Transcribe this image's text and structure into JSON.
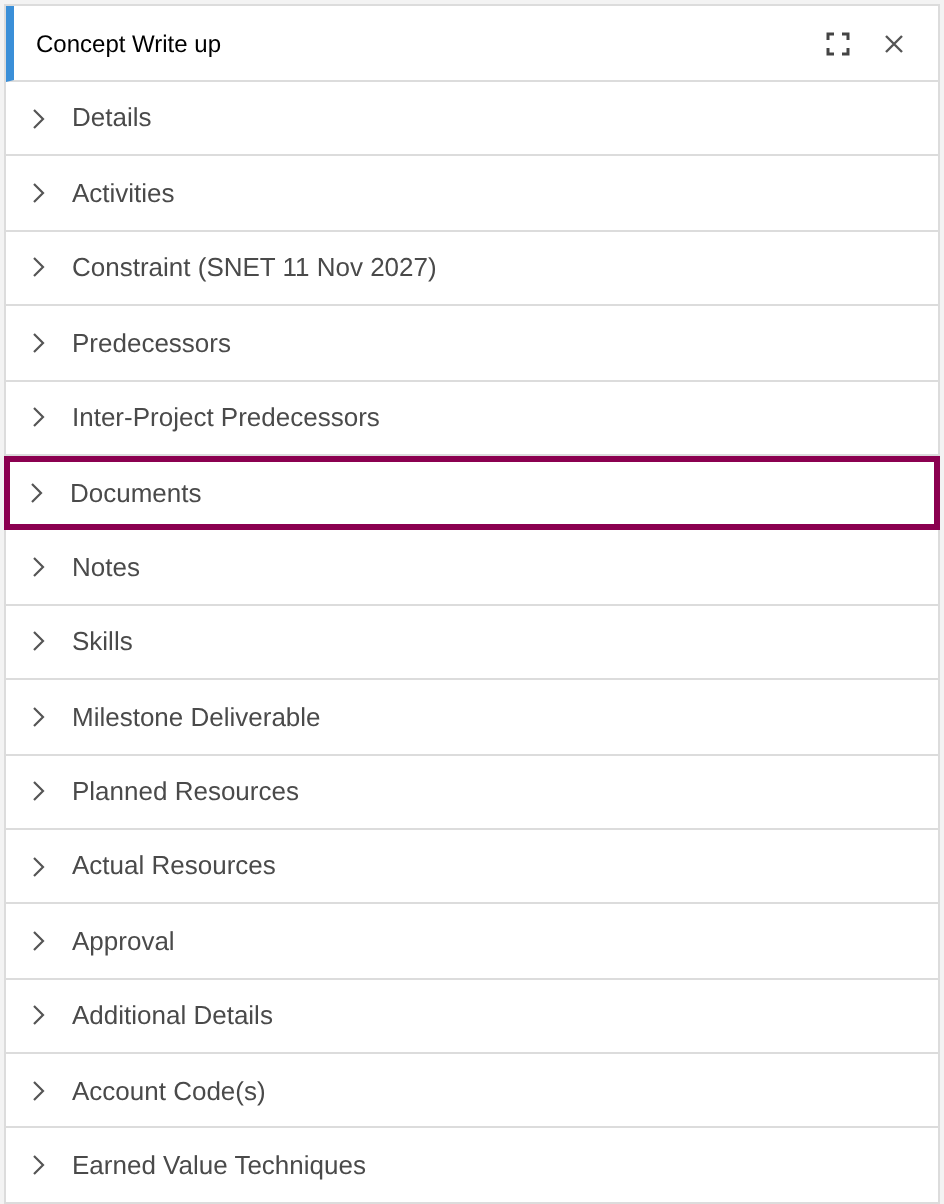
{
  "panel": {
    "title": "Concept Write up"
  },
  "sections": [
    {
      "label": "Details",
      "expanded": false,
      "selected": false
    },
    {
      "label": "Activities",
      "expanded": false,
      "selected": false
    },
    {
      "label": "Constraint (SNET 11 Nov 2027)",
      "expanded": false,
      "selected": false
    },
    {
      "label": "Predecessors",
      "expanded": false,
      "selected": false
    },
    {
      "label": "Inter-Project Predecessors",
      "expanded": false,
      "selected": false
    },
    {
      "label": "Documents",
      "expanded": false,
      "selected": true
    },
    {
      "label": "Notes",
      "expanded": false,
      "selected": false
    },
    {
      "label": "Skills",
      "expanded": false,
      "selected": false
    },
    {
      "label": "Milestone Deliverable",
      "expanded": false,
      "selected": false
    },
    {
      "label": "Planned Resources",
      "expanded": false,
      "selected": false
    },
    {
      "label": "Actual Resources",
      "expanded": false,
      "selected": false
    },
    {
      "label": "Approval",
      "expanded": false,
      "selected": false
    },
    {
      "label": "Additional Details",
      "expanded": false,
      "selected": false
    },
    {
      "label": "Account Code(s)",
      "expanded": false,
      "selected": false
    },
    {
      "label": "Earned Value Techniques",
      "expanded": false,
      "selected": false
    }
  ]
}
